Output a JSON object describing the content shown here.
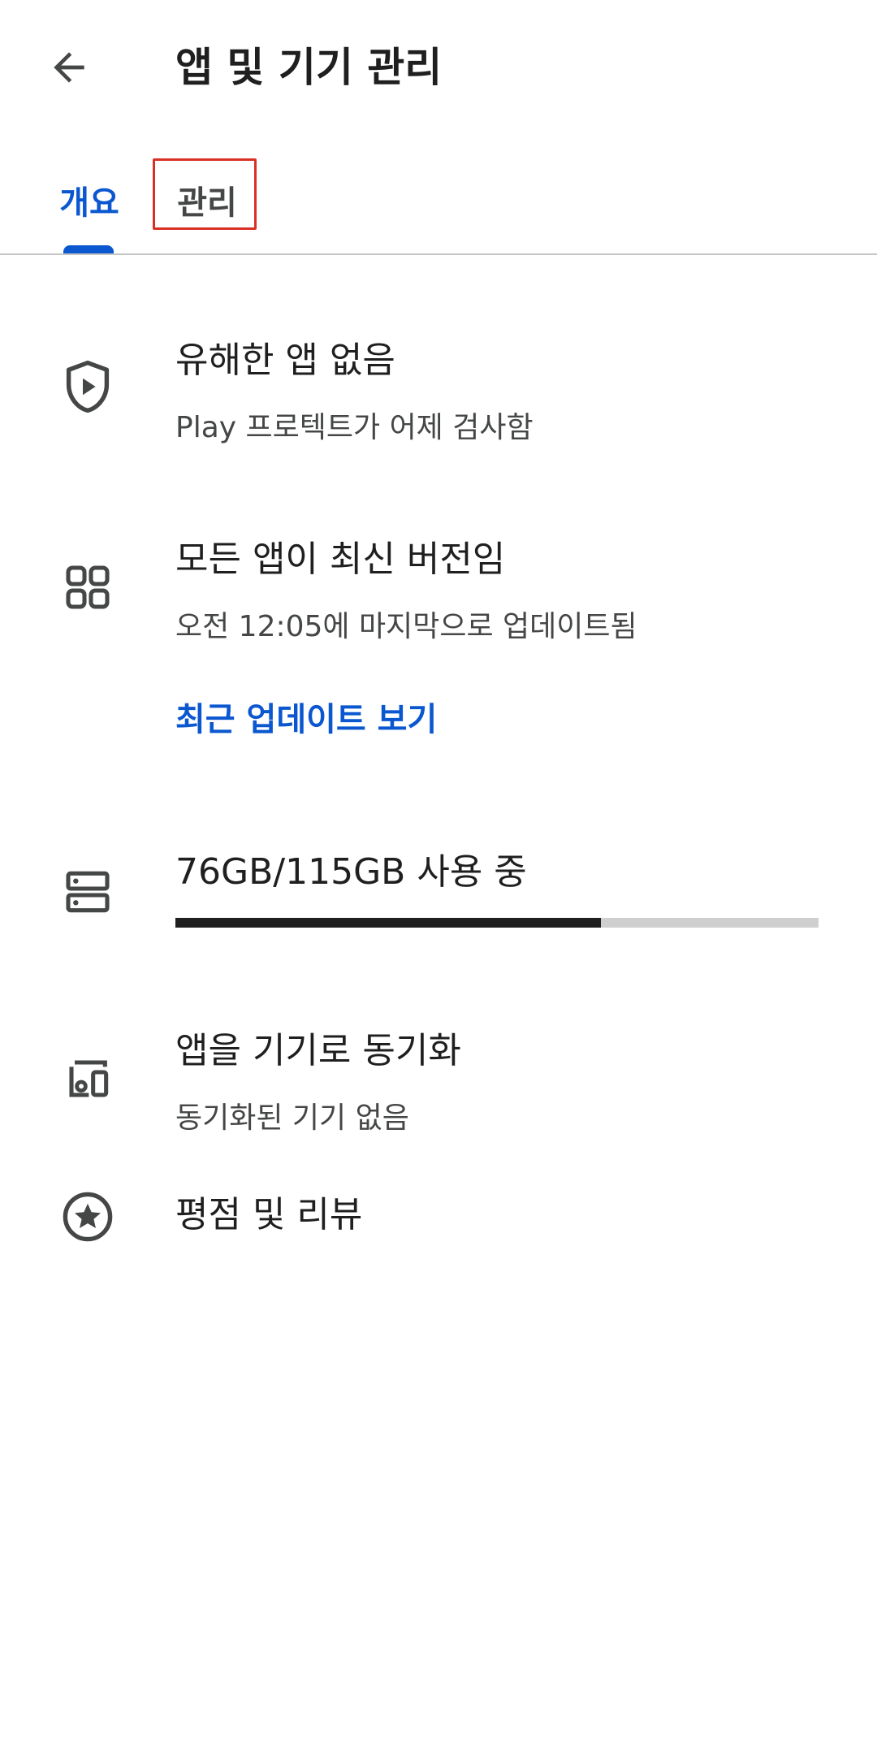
{
  "header": {
    "title": "앱 및 기기 관리",
    "back_icon": "arrow-back-icon"
  },
  "tabs": [
    {
      "label": "개요",
      "selected": true
    },
    {
      "label": "관리",
      "selected": false
    }
  ],
  "colors": {
    "accent": "#0b57d0",
    "focus_outline": "#d93025",
    "storage_fill": "#1f1f1f",
    "storage_track": "#cfcfcf"
  },
  "items": {
    "protect": {
      "icon": "shield-play-icon",
      "title": "유해한 앱 없음",
      "subtitle": "Play 프로텍트가 어제 검사함"
    },
    "updates": {
      "icon": "apps-grid-icon",
      "title": "모든 앱이 최신 버전임",
      "subtitle": "오전 12:05에 마지막으로 업데이트됨",
      "link": "최근 업데이트 보기"
    },
    "storage": {
      "icon": "storage-icon",
      "title": "76GB/115GB 사용 중",
      "used_fraction": 0.661
    },
    "sync": {
      "icon": "devices-icon",
      "title": "앱을 기기로 동기화",
      "subtitle": "동기화된 기기 없음"
    },
    "ratings": {
      "icon": "star-circle-icon",
      "title": "평점 및 리뷰"
    }
  }
}
